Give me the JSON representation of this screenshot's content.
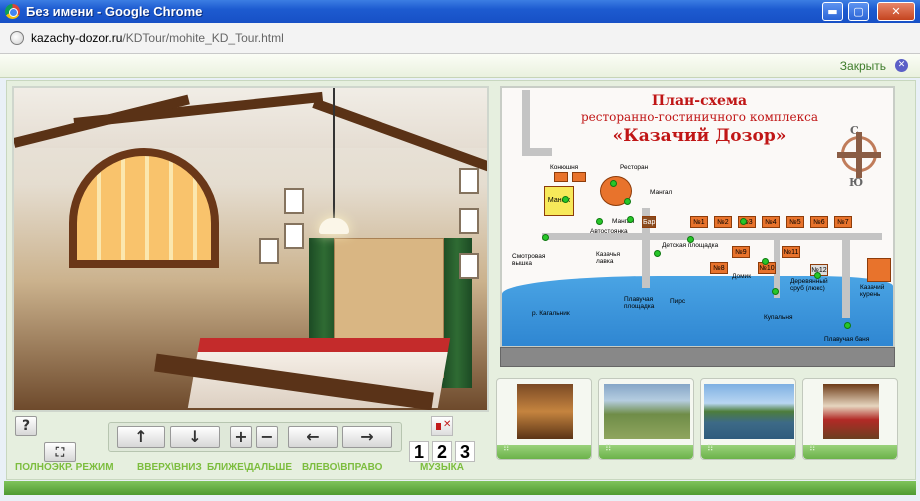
{
  "window": {
    "title": "Без имени - Google Chrome",
    "controls": {
      "minimize": "▬",
      "maximize": "▢",
      "close": "✕"
    }
  },
  "address": {
    "host": "kazachy-dozor.ru",
    "path": "/KDTour/mohite_KD_Tour.html"
  },
  "closebar": {
    "label": "Закрыть",
    "icon": "close-circle-icon"
  },
  "controls": {
    "help": "?",
    "fullscreen_label": "ПОЛНОЭКР. РЕЖИМ",
    "updown_label": "ВВЕРХ\\ВНИЗ",
    "zoom_label": "БЛИЖЕ\\ДАЛЬШЕ",
    "leftright_label": "ВЛЕВО\\ВПРАВО",
    "music_label": "МУЗЫКА",
    "up": "↑",
    "down": "↓",
    "plus": "+",
    "minus": "−",
    "left": "←",
    "right": "→",
    "tracks": [
      "1",
      "2",
      "3"
    ]
  },
  "map": {
    "title_line1": "План-схема",
    "title_line2": "ресторанно-гостиничного комплекса",
    "title_line3": "«Казачий Дозор»",
    "compass_north": "С",
    "compass_south": "Ю",
    "labels": {
      "stable": "Конюшня",
      "restaurant": "Ресторан",
      "mangal": "Мангал",
      "manezh": "Манеж",
      "bar": "Бар",
      "mangal2": "Мангал",
      "parking": "Автостоянка",
      "playground": "Детская площадка",
      "tower": "Смотровая вышка",
      "shop": "Казачья лавка",
      "float_area": "Плавучая площадка",
      "pier": "Пирс",
      "river": "р. Кагальник",
      "bath": "Купальня",
      "domik": "Домик",
      "log_lux": "Деревянный сруб (люкс)",
      "float_bath": "Плавучая баня",
      "kazachiy_kuren": "Казачий курень"
    },
    "houses": [
      "№1",
      "№2",
      "№3",
      "№4",
      "№5",
      "№6",
      "№7",
      "№8",
      "№9",
      "№10",
      "№11",
      "№12"
    ]
  }
}
